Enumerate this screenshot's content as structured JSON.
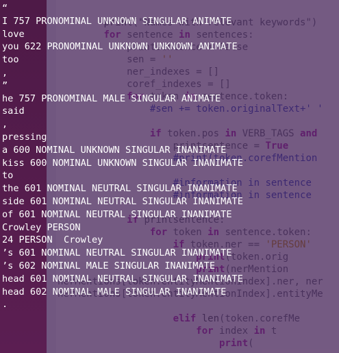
{
  "editor": {
    "code_lines": [
      [
        {
          "t": "        "
        },
        {
          "t": "print",
          "c": "nm"
        },
        {
          "t": "(\"Names with relevant keywords\")"
        }
      ],
      [
        {
          "t": "        "
        },
        {
          "t": "for",
          "c": "kw"
        },
        {
          "t": " sentence "
        },
        {
          "t": "in",
          "c": "kw"
        },
        {
          "t": " sentences:"
        }
      ],
      [
        {
          "t": "            printsentence = False"
        }
      ],
      [
        {
          "t": "            sen = "
        },
        {
          "t": "''",
          "c": "st"
        }
      ],
      [
        {
          "t": "            ner_indexes = []"
        }
      ],
      [
        {
          "t": "            coref_indexes = []"
        }
      ],
      [
        {
          "t": "            "
        },
        {
          "t": "for",
          "c": "kw"
        },
        {
          "t": " token "
        },
        {
          "t": "in",
          "c": "kw"
        },
        {
          "t": " sentence.token:"
        }
      ],
      [
        {
          "t": "                "
        },
        {
          "t": "#sen += token.originalText+' '",
          "c": "cm"
        }
      ],
      [
        {
          "t": ""
        }
      ],
      [
        {
          "t": "                "
        },
        {
          "t": "if",
          "c": "kw"
        },
        {
          "t": " token.pos "
        },
        {
          "t": "in",
          "c": "kw"
        },
        {
          "t": " VERB_TAGS "
        },
        {
          "t": "and",
          "c": "kw"
        }
      ],
      [
        {
          "t": "                    printsentence = "
        },
        {
          "t": "True",
          "c": "kw"
        }
      ],
      [
        {
          "t": "                    "
        },
        {
          "t": "#print(token.corefMention",
          "c": "cm"
        }
      ],
      [
        {
          "t": ""
        }
      ],
      [
        {
          "t": "                    "
        },
        {
          "t": "#information in sentence",
          "c": "cm"
        }
      ],
      [
        {
          "t": "                    "
        },
        {
          "t": "#information in sentence",
          "c": "cm"
        }
      ],
      [
        {
          "t": ""
        }
      ],
      [
        {
          "t": "            "
        },
        {
          "t": "if",
          "c": "kw"
        },
        {
          "t": " printsentence:"
        }
      ],
      [
        {
          "t": "                "
        },
        {
          "t": "for",
          "c": "kw"
        },
        {
          "t": " token "
        },
        {
          "t": "in",
          "c": "kw"
        },
        {
          "t": " sentence.token:"
        }
      ],
      [
        {
          "t": "                    "
        },
        {
          "t": "if",
          "c": "kw"
        },
        {
          "t": " token.ner == "
        },
        {
          "t": "'PERSON'",
          "c": "st"
        }
      ],
      [
        {
          "t": "                        "
        },
        {
          "t": "print",
          "c": "kw"
        },
        {
          "t": "(token.orig"
        }
      ],
      [
        {
          "t": "                        "
        },
        {
          "t": "print",
          "c": "kw"
        },
        {
          "t": "(nerMention"
        }
      ],
      [
        {
          "t": "nerMentions[token.entityMentionIndex].ner, ner"
        }
      ],
      [
        {
          "t": "nerMentions[token.entityMentionIndex].entityMe"
        }
      ],
      [
        {
          "t": ""
        }
      ],
      [
        {
          "t": "                    "
        },
        {
          "t": "elif",
          "c": "kw"
        },
        {
          "t": " "
        },
        {
          "t": "len",
          "c": "nm"
        },
        {
          "t": "(token.corefMe"
        }
      ],
      [
        {
          "t": "                        "
        },
        {
          "t": "for",
          "c": "kw"
        },
        {
          "t": " index "
        },
        {
          "t": "in",
          "c": "kw"
        },
        {
          "t": " t"
        }
      ],
      [
        {
          "t": "                            "
        },
        {
          "t": "print",
          "c": "kw"
        },
        {
          "t": "("
        }
      ]
    ]
  },
  "terminal": {
    "lines": [
      "“",
      "I 757 PRONOMINAL UNKNOWN SINGULAR ANIMATE",
      "love",
      "you 622 PRONOMINAL UNKNOWN UNKNOWN ANIMATE",
      "too",
      ",",
      "”",
      "he 757 PRONOMINAL MALE SINGULAR ANIMATE",
      "said",
      ",",
      "pressing",
      "a 600 NOMINAL UNKNOWN SINGULAR INANIMATE",
      "kiss 600 NOMINAL UNKNOWN SINGULAR INANIMATE",
      "to",
      "the 601 NOMINAL NEUTRAL SINGULAR INANIMATE",
      "side 601 NOMINAL NEUTRAL SINGULAR INANIMATE",
      "of 601 NOMINAL NEUTRAL SINGULAR INANIMATE",
      "Crowley PERSON",
      "24 PERSON  Crowley",
      "’s 601 NOMINAL NEUTRAL SINGULAR INANIMATE",
      "’s 602 NOMINAL MALE SINGULAR INANIMATE",
      "head 601 NOMINAL NEUTRAL SINGULAR INANIMATE",
      "head 602 NOMINAL MALE SINGULAR INANIMATE",
      "."
    ]
  }
}
